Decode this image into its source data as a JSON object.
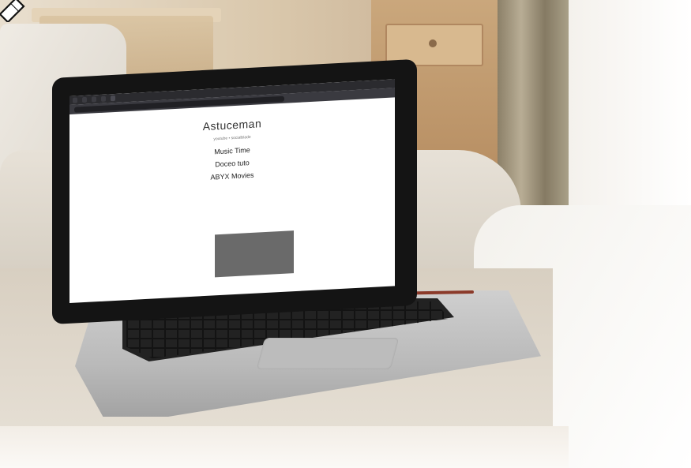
{
  "browser": {
    "tabs": [
      "",
      "",
      "",
      "",
      ""
    ],
    "url": ""
  },
  "website": {
    "title": "Astuceman",
    "subtitle": "youtube • socialblade",
    "entries": [
      {
        "title": "Music Time"
      },
      {
        "title": "Doceo tuto"
      },
      {
        "title": "ABYX Movies"
      }
    ]
  },
  "cookie_banner": {
    "text": ""
  },
  "overlay": {
    "corner_icon": "pen-icon"
  },
  "colors": {
    "screen_bg": "#ffffff",
    "cookie_box": "#6a6a6a",
    "laptop_body": "#141414",
    "sofa": "#e7e1d7"
  }
}
